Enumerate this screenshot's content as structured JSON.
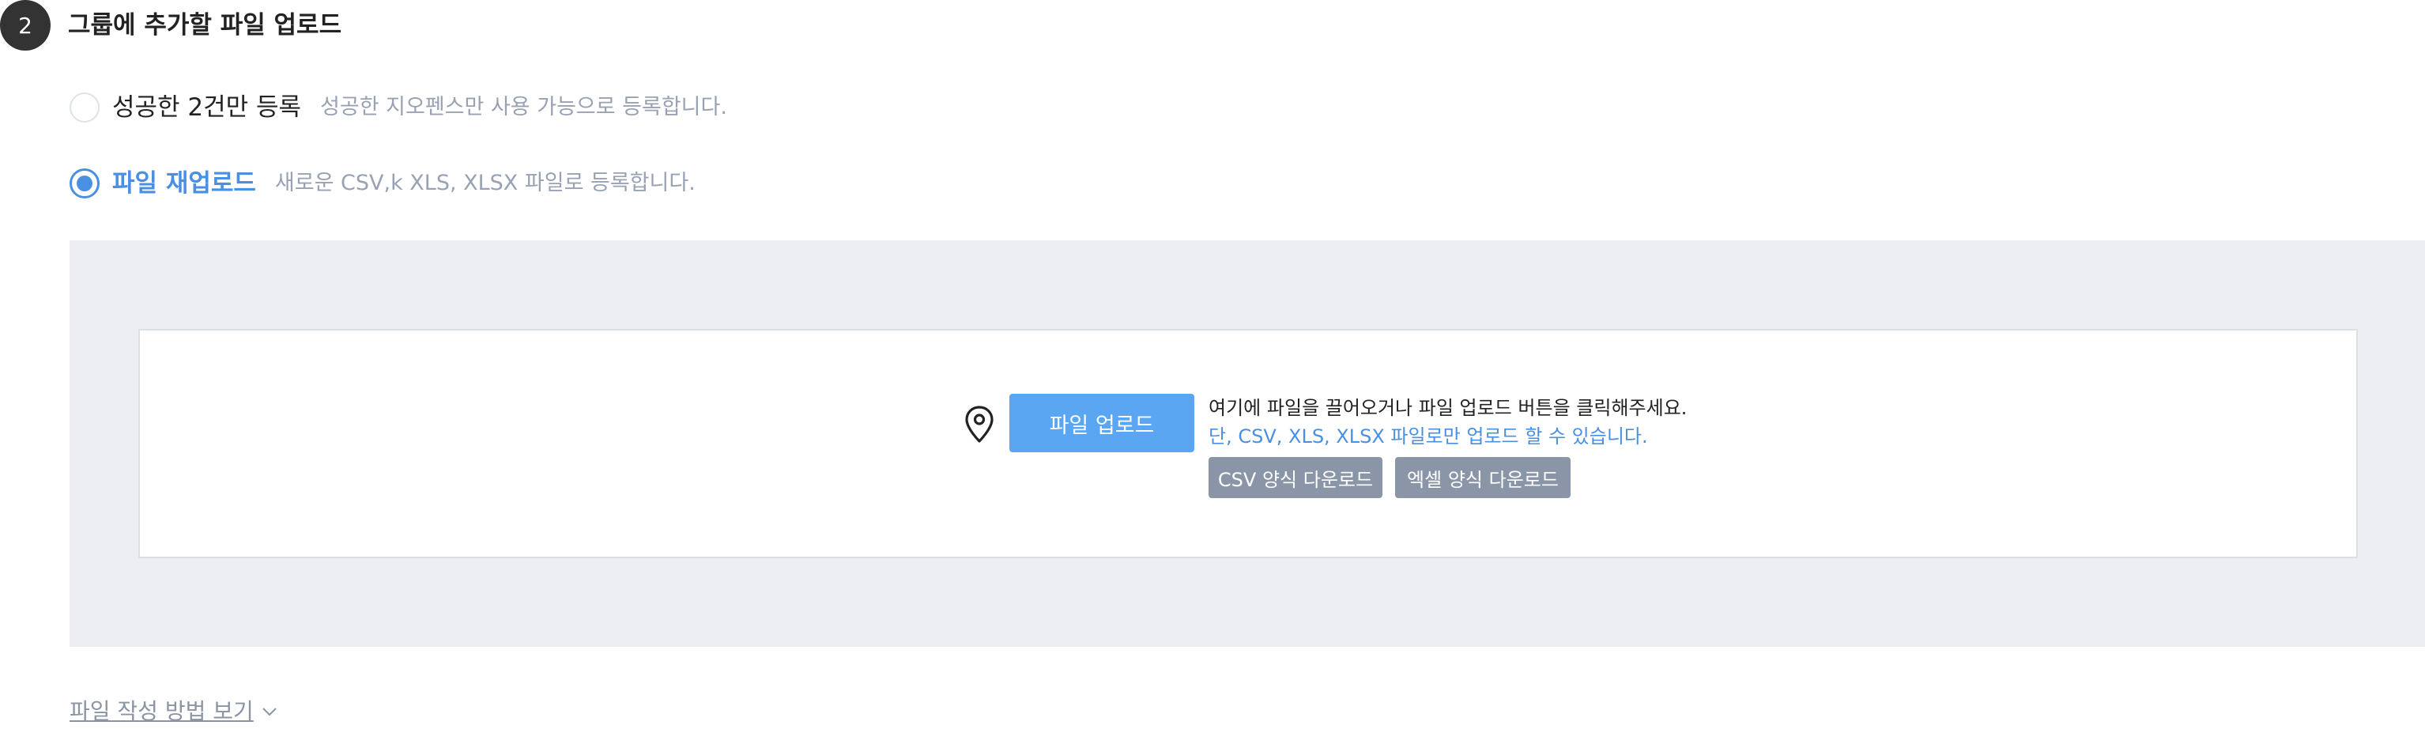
{
  "step": {
    "number": "2",
    "title": "그룹에 추가할 파일 업로드"
  },
  "options": [
    {
      "label": "성공한 2건만 등록",
      "description": "성공한 지오펜스만 사용 가능으로 등록합니다.",
      "selected": false
    },
    {
      "label": "파일 재업로드",
      "description": "새로운 CSV,k XLS, XLSX 파일로 등록합니다.",
      "selected": true
    }
  ],
  "upload": {
    "icon": "map-pin-icon",
    "button_label": "파일 업로드",
    "instruction": "여기에 파일을 끌어오거나 파일 업로드 버튼을 클릭해주세요.",
    "note": "단, CSV, XLS, XLSX 파일로만 업로드 할 수 있습니다.",
    "csv_template_label": "CSV 양식 다운로드",
    "excel_template_label": "엑셀 양식 다운로드"
  },
  "guide": {
    "label": "파일 작성 방법 보기",
    "icon": "chevron-down-icon"
  },
  "colors": {
    "accent": "#4a90e2",
    "upload_button": "#5aa6f2",
    "template_button": "#8a96a8",
    "panel_background": "#edeef2",
    "step_badge": "#333333"
  }
}
